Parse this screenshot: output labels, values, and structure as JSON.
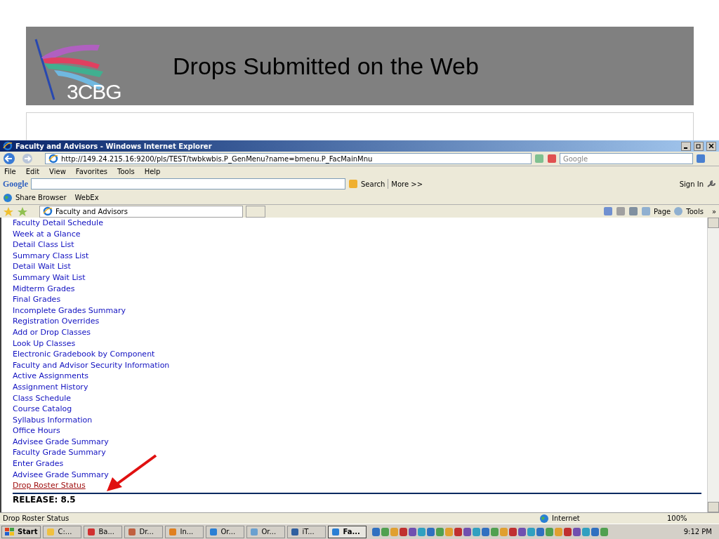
{
  "slide": {
    "logo_text": "3CBG",
    "title": "Drops Submitted on the Web"
  },
  "browser": {
    "title": "Faculty and Advisors - Windows Internet Explorer",
    "url": "http://149.24.215.16:9200/pls/TEST/twbkwbis.P_GenMenu?name=bmenu.P_FacMainMnu",
    "search_placeholder": "Google",
    "menu": [
      "File",
      "Edit",
      "View",
      "Favorites",
      "Tools",
      "Help"
    ],
    "google_bar": {
      "logo": "Google",
      "search": "Search",
      "more": "More >>",
      "sign_in": "Sign In"
    },
    "links_bar": {
      "share": "Share Browser",
      "webex": "WebEx"
    },
    "tab": "Faculty and Advisors",
    "command_bar": {
      "page": "Page",
      "tools": "Tools",
      "overflow": "»"
    },
    "links": [
      {
        "label": "Faculty Detail Schedule",
        "selected": false
      },
      {
        "label": "Week at a Glance",
        "selected": false
      },
      {
        "label": "Detail Class List",
        "selected": false
      },
      {
        "label": "Summary Class List",
        "selected": false
      },
      {
        "label": "Detail Wait List",
        "selected": false
      },
      {
        "label": "Summary Wait List",
        "selected": false
      },
      {
        "label": "Midterm Grades",
        "selected": false
      },
      {
        "label": "Final Grades",
        "selected": false
      },
      {
        "label": "Incomplete Grades Summary",
        "selected": false
      },
      {
        "label": "Registration Overrides",
        "selected": false
      },
      {
        "label": "Add or Drop Classes",
        "selected": false
      },
      {
        "label": "Look Up Classes",
        "selected": false
      },
      {
        "label": "Electronic Gradebook by Component",
        "selected": false
      },
      {
        "label": "Faculty and Advisor Security Information",
        "selected": false
      },
      {
        "label": "Active Assignments",
        "selected": false
      },
      {
        "label": "Assignment History",
        "selected": false
      },
      {
        "label": "Class Schedule",
        "selected": false
      },
      {
        "label": "Course Catalog",
        "selected": false
      },
      {
        "label": "Syllabus Information",
        "selected": false
      },
      {
        "label": "Office Hours",
        "selected": false
      },
      {
        "label": "Advisee Grade Summary",
        "selected": false
      },
      {
        "label": "Faculty Grade Summary",
        "selected": false
      },
      {
        "label": "Enter Grades",
        "selected": false
      },
      {
        "label": "Advisee Grade Summary",
        "selected": false
      },
      {
        "label": "Drop Roster Status",
        "selected": true
      }
    ],
    "release": "RELEASE: 8.5",
    "status_text": "Drop Roster Status",
    "zone": "Internet",
    "zoom": "100%"
  },
  "taskbar": {
    "start": "Start",
    "clock": "9:12 PM",
    "buttons": [
      {
        "label": "C:...",
        "selected": false
      },
      {
        "label": "Ba...",
        "selected": false
      },
      {
        "label": "Dr...",
        "selected": false
      },
      {
        "label": "In...",
        "selected": false
      },
      {
        "label": "Or...",
        "selected": false
      },
      {
        "label": "Or...",
        "selected": false
      },
      {
        "label": "iT...",
        "selected": false
      },
      {
        "label": "Fa...",
        "selected": true
      }
    ]
  }
}
